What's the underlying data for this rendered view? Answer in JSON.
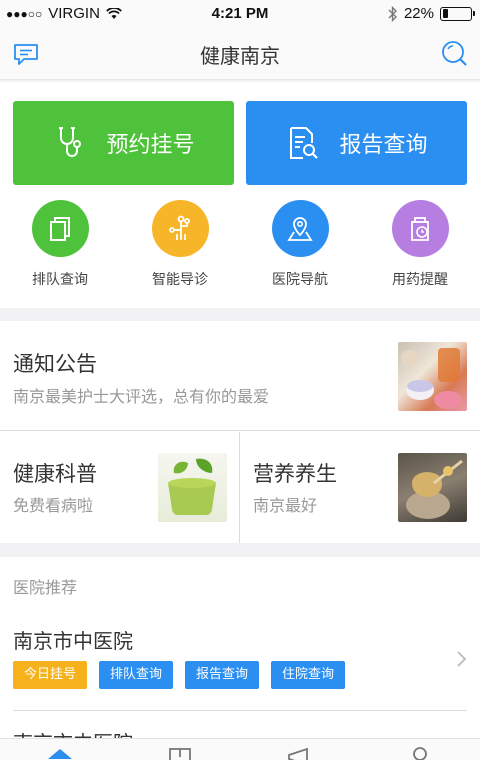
{
  "status_bar": {
    "carrier": "VIRGIN",
    "signal_dots": "●●●○○",
    "time": "4:21 PM",
    "battery_percent": "22%",
    "battery_level": 0.22
  },
  "nav": {
    "title": "健康南京",
    "left_icon": "message-icon",
    "right_icon": "search-icon"
  },
  "quick_actions": {
    "appointment_label": "预约挂号",
    "report_label": "报告查询"
  },
  "shortcuts": [
    {
      "label": "排队查询",
      "icon": "queue-icon",
      "color": "#4ec23b"
    },
    {
      "label": "智能导诊",
      "icon": "guide-icon",
      "color": "#f7b52a"
    },
    {
      "label": "医院导航",
      "icon": "map-pin-icon",
      "color": "#2b8ff1"
    },
    {
      "label": "用药提醒",
      "icon": "medicine-clock-icon",
      "color": "#b57ee0"
    }
  ],
  "news": {
    "notice_title": "通知公告",
    "notice_subtitle": "南京最美护士大评选，总有你的最爱",
    "health_title": "健康科普",
    "health_subtitle": "免费看病啦",
    "nutrition_title": "营养养生",
    "nutrition_subtitle": "南京最好"
  },
  "hospitals": {
    "section_label": "医院推荐",
    "first_name": "南京市中医院",
    "tags": [
      "今日挂号",
      "排队查询",
      "报告查询",
      "住院查询"
    ],
    "second_name": "南京市中医院"
  },
  "colors": {
    "green": "#4ec23b",
    "blue": "#2b8ff1",
    "orange": "#f5b21c"
  }
}
